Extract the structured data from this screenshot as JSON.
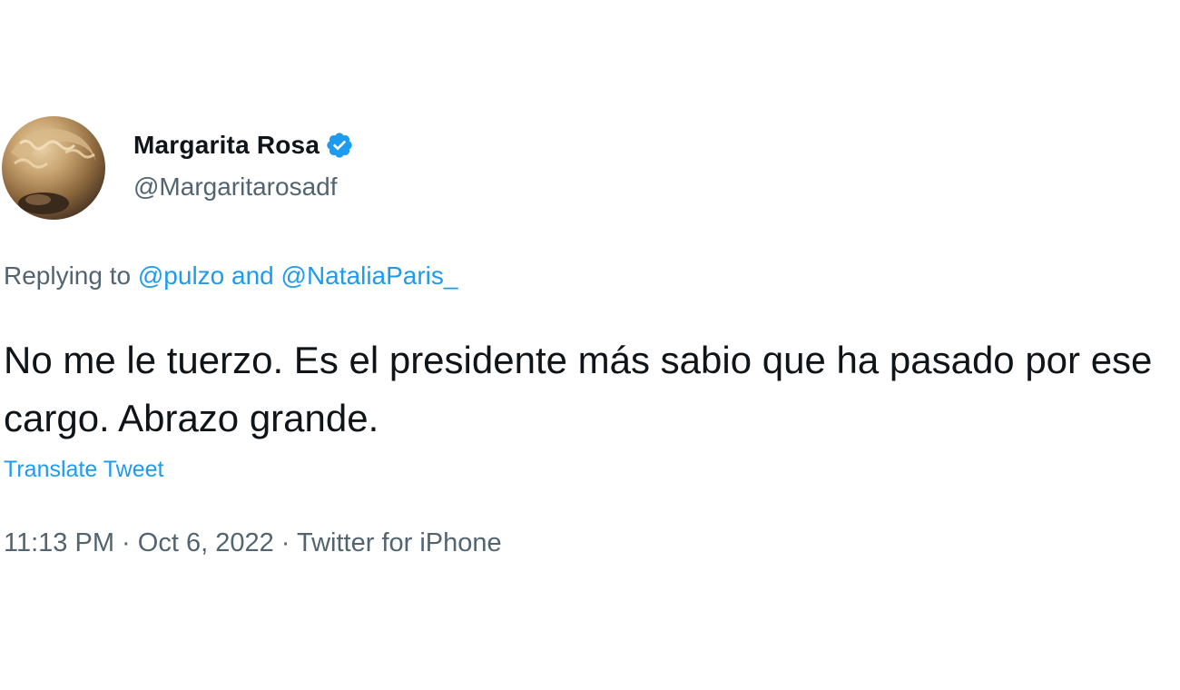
{
  "author": {
    "display_name": "Margarita Rosa",
    "handle": "@Margaritarosadf",
    "verified_icon": "verified-badge-icon"
  },
  "reply": {
    "prefix": "Replying to",
    "mention_1": "@pulzo",
    "joiner": "and",
    "mention_2": "@NataliaParis_"
  },
  "body": {
    "text": "No me le tuerzo. Es el presidente más sabio que ha pasado por ese cargo. Abrazo grande."
  },
  "actions": {
    "translate_label": "Translate Tweet"
  },
  "meta": {
    "time": "11:13 PM",
    "separator": "·",
    "date": "Oct 6, 2022",
    "source": "Twitter for iPhone"
  },
  "colors": {
    "link": "#1d9bf0",
    "secondary_text": "#536471",
    "primary_text": "#0f1419"
  }
}
